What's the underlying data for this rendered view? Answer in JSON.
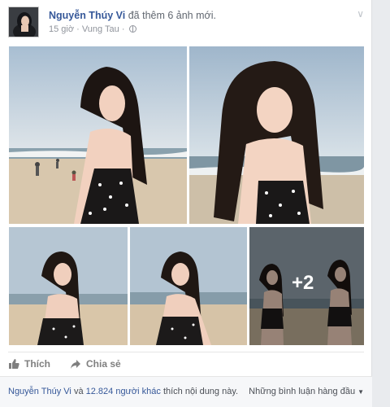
{
  "post": {
    "author": "Nguyễn Thúy Vi",
    "action": "đã thêm 6 ảnh mới.",
    "time": "15 giờ",
    "separator": "·",
    "location": "Vung Tau",
    "separator2": "·",
    "privacy_icon": "globe-icon",
    "menu_icon": "chevron-down-icon"
  },
  "photos": {
    "more_count": "+2"
  },
  "actions": {
    "like": "Thích",
    "share": "Chia sẻ"
  },
  "summary": {
    "liked_name": "Nguyễn Thúy Vi",
    "liked_and": "và",
    "liked_others": "12.824 người khác",
    "liked_suffix": "thích nội dung này.",
    "comments_sort": "Những bình luận hàng đầu"
  },
  "colors": {
    "link": "#365899",
    "muted": "#90949c",
    "summary_bg": "#f6f7f9"
  }
}
